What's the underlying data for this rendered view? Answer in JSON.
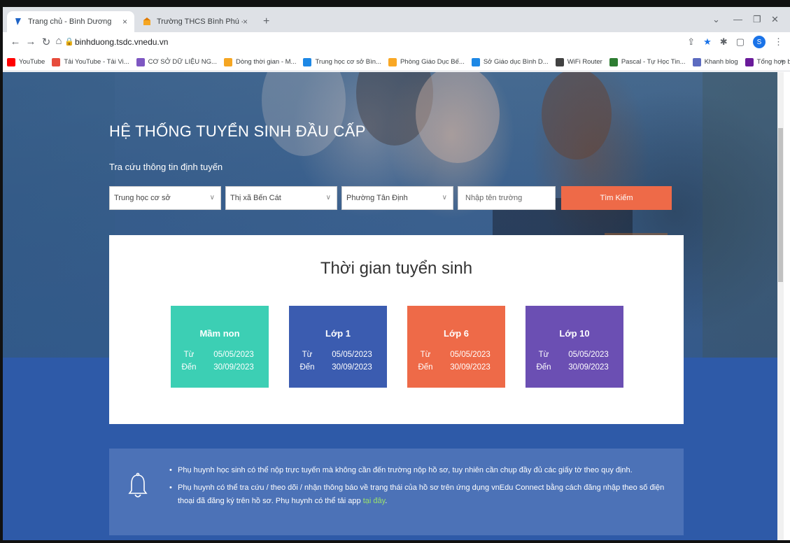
{
  "browser": {
    "tabs": [
      {
        "title": "Trang chủ - Bình Dương",
        "active": true
      },
      {
        "title": "Trường THCS Bình Phú - Bình Dư",
        "active": false
      }
    ],
    "tab_close": "×",
    "new_tab": "+",
    "url": "binhduong.tsdc.vnedu.vn",
    "avatar_letter": "S",
    "bookmarks": [
      {
        "label": "YouTube",
        "color": "#ff0000"
      },
      {
        "label": "Tải YouTube - Tải Vi...",
        "color": "#e74c3c"
      },
      {
        "label": "CƠ SỞ DỮ LIỆU NG...",
        "color": "#7e57c2"
      },
      {
        "label": "Dòng thời gian - M...",
        "color": "#f5a623"
      },
      {
        "label": "Trung học cơ sở Bìn...",
        "color": "#1e88e5"
      },
      {
        "label": "Phòng Giáo Dục Bế...",
        "color": "#f9a825"
      },
      {
        "label": "Sở Giáo dục Bình D...",
        "color": "#1e88e5"
      },
      {
        "label": "WiFi Router",
        "color": "#424242"
      },
      {
        "label": "Pascal - Tự Học Tin...",
        "color": "#2e7d32"
      },
      {
        "label": "Khanh blog",
        "color": "#5c6bc0"
      },
      {
        "label": "Tổng hợp bài tập P...",
        "color": "#6a1b9a"
      }
    ],
    "bookmarks_more": "»"
  },
  "hero": {
    "title": "HỆ THỐNG TUYỂN SINH ĐẦU CẤP",
    "subtitle": "Tra cứu thông tin định tuyến",
    "filters": {
      "level": "Trung học cơ sở",
      "district": "Thị xã Bến Cát",
      "ward": "Phường Tân Định",
      "school_placeholder": "Nhập tên trường",
      "search_button": "Tìm Kiếm"
    }
  },
  "schedule": {
    "title": "Thời gian tuyển sinh",
    "from_label": "Từ",
    "to_label": "Đến",
    "tiles": [
      {
        "name": "Mầm non",
        "from": "05/05/2023",
        "to": "30/09/2023",
        "color": "#3ccfb4"
      },
      {
        "name": "Lớp 1",
        "from": "05/05/2023",
        "to": "30/09/2023",
        "color": "#3b5cb0"
      },
      {
        "name": "Lớp 6",
        "from": "05/05/2023",
        "to": "30/09/2023",
        "color": "#ee6a48"
      },
      {
        "name": "Lớp 10",
        "from": "05/05/2023",
        "to": "30/09/2023",
        "color": "#6b4fb3"
      }
    ]
  },
  "notice": {
    "items": [
      "Phụ huynh học sinh có thể nộp trực tuyến mà không cần đến trường nộp hồ sơ, tuy nhiên cần chụp đầy đủ các giấy tờ theo quy định.",
      "Phụ huynh có thể tra cứu / theo dõi / nhận thông báo về trạng thái của hồ sơ trên ứng dụng vnEdu Connect bằng cách đăng nhập theo số điện thoại đã đăng ký trên hồ sơ. Phụ huynh có thể tải app"
    ],
    "link_text": "tại đây",
    "link_suffix": "."
  }
}
